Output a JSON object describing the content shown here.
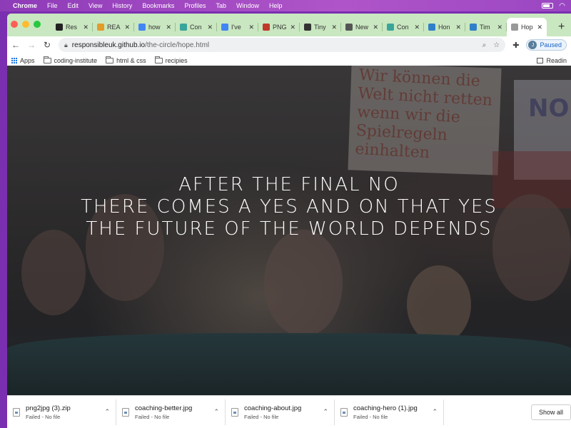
{
  "menubar": {
    "app": "Chrome",
    "items": [
      "File",
      "Edit",
      "View",
      "History",
      "Bookmarks",
      "Profiles",
      "Tab",
      "Window",
      "Help"
    ]
  },
  "tabs": [
    {
      "label": "Res",
      "icon": "github-icon",
      "color": "#222222"
    },
    {
      "label": "REA",
      "icon": "google-icon",
      "color": "#e39b2a"
    },
    {
      "label": "how",
      "icon": "google-icon",
      "color": "#4285f4"
    },
    {
      "label": "Con",
      "icon": "leaf-icon",
      "color": "#3aa59a"
    },
    {
      "label": "I've",
      "icon": "google-icon",
      "color": "#4285f4"
    },
    {
      "label": "PNG",
      "icon": "png-icon",
      "color": "#c0392b"
    },
    {
      "label": "Tiny",
      "icon": "panda-icon",
      "color": "#333333"
    },
    {
      "label": "New",
      "icon": "chrome-icon",
      "color": "#555555"
    },
    {
      "label": "Con",
      "icon": "leaf-icon",
      "color": "#3aa59a"
    },
    {
      "label": "Hon",
      "icon": "c-icon",
      "color": "#2f80c8"
    },
    {
      "label": "Tim",
      "icon": "c-icon",
      "color": "#2f80c8"
    },
    {
      "label": "Hop",
      "icon": "globe-icon",
      "color": "#999999",
      "active": true
    }
  ],
  "address": {
    "host": "responsibleuk.github.io",
    "path": "/the-circle/hope.html"
  },
  "profile": {
    "initial": "J",
    "status": "Paused"
  },
  "bookmarks": {
    "apps": "Apps",
    "folders": [
      "coding-institute",
      "html & css",
      "recipies"
    ],
    "reading_list": "Readin"
  },
  "hero": {
    "lines": [
      "AFTER THE FINAL NO",
      "THERE COMES A YES AND ON THAT YES",
      "THE FUTURE OF THE WORLD DEPENDS"
    ],
    "sign_text": "Wir können die Welt nicht retten wenn wir die Spielregeln einhalten",
    "side_sign_text": "NO"
  },
  "downloads": {
    "items": [
      {
        "name": "png2jpg (3).zip",
        "status": "Failed - No file"
      },
      {
        "name": "coaching-better.jpg",
        "status": "Failed - No file"
      },
      {
        "name": "coaching-about.jpg",
        "status": "Failed - No file"
      },
      {
        "name": "coaching-hero (1).jpg",
        "status": "Failed - No file"
      }
    ],
    "show_all": "Show all"
  }
}
